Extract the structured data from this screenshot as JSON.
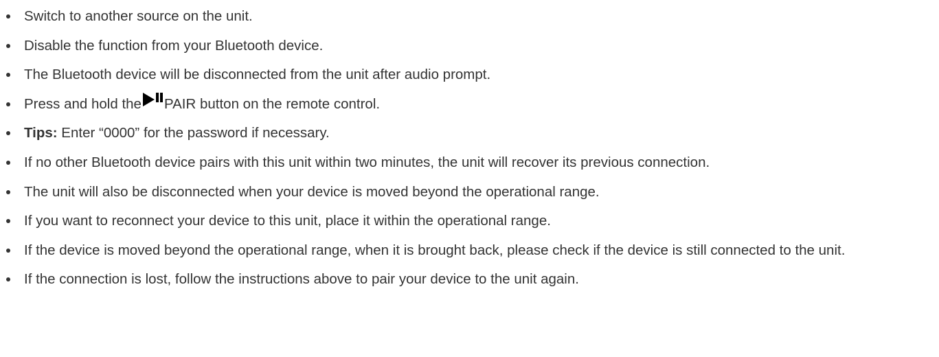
{
  "items": [
    {
      "text": "Switch to another source on the unit."
    },
    {
      "text": "Disable the function from your Bluetooth device."
    },
    {
      "text": "The Bluetooth device will be disconnected from the unit after audio prompt."
    },
    {
      "before": "Press and hold the",
      "icon": "play-pause-icon",
      "after": "PAIR button on the remote control."
    },
    {
      "bold": "Tips:",
      "text": " Enter “0000” for the password if necessary."
    },
    {
      "text": "If no other Bluetooth device pairs with this unit within two minutes, the unit will recover its previous connection."
    },
    {
      "text": "The unit will also be disconnected when your device is moved beyond the operational range."
    },
    {
      "text": "If you want to reconnect your device to this unit, place it within the operational range."
    },
    {
      "text": "If the device is moved beyond the operational range, when it is brought back, please check if the device is still connected to the unit."
    },
    {
      "text": "If the connection is lost, follow the instructions above to pair your device to the unit again."
    }
  ],
  "colors": {
    "text": "#333333",
    "icon": "#000000",
    "background": "#ffffff"
  }
}
